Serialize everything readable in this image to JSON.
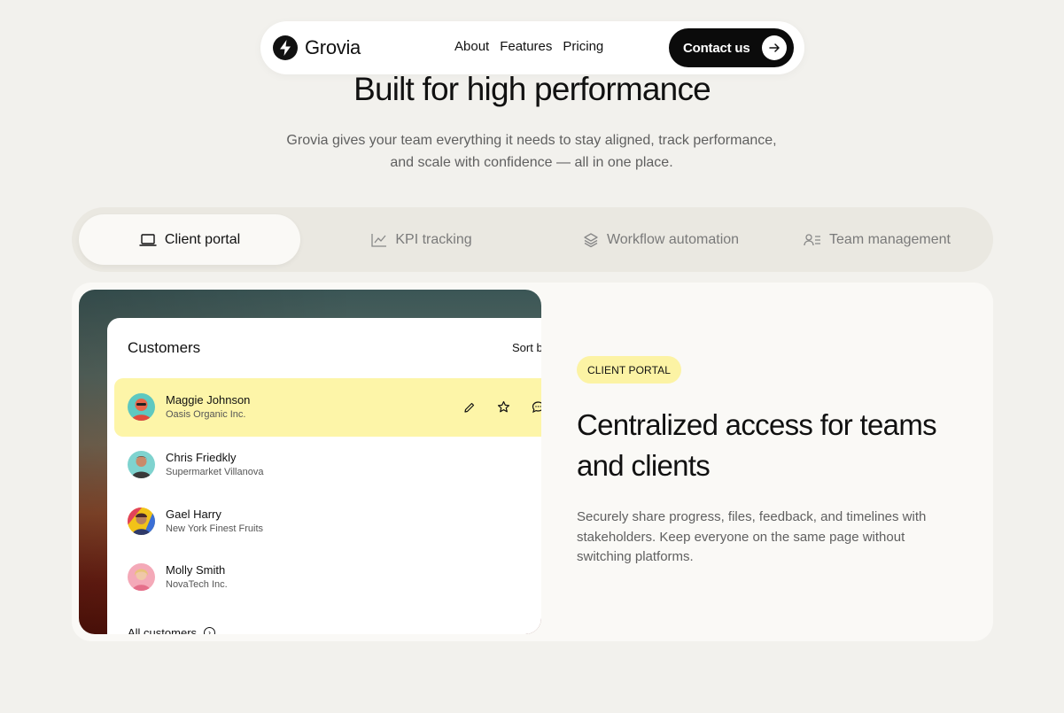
{
  "nav": {
    "brand": "Grovia",
    "links": [
      "About",
      "Features",
      "Pricing"
    ],
    "cta_label": "Contact us"
  },
  "hero": {
    "title": "Built for high performance",
    "subtitle_line1": "Grovia gives your team everything it needs to stay aligned, track performance,",
    "subtitle_line2": "and scale with confidence — all in one place."
  },
  "tabs": [
    {
      "label": "Client portal",
      "icon": "laptop-icon",
      "active": true
    },
    {
      "label": "KPI tracking",
      "icon": "chart-icon",
      "active": false
    },
    {
      "label": "Workflow automation",
      "icon": "layers-icon",
      "active": false
    },
    {
      "label": "Team management",
      "icon": "team-icon",
      "active": false
    }
  ],
  "customers_panel": {
    "title": "Customers",
    "sort_label": "Sort by",
    "rows": [
      {
        "name": "Maggie Johnson",
        "company": "Oasis Organic Inc.",
        "highlighted": true
      },
      {
        "name": "Chris Friedkly",
        "company": "Supermarket Villanova",
        "highlighted": false
      },
      {
        "name": "Gael Harry",
        "company": "New York Finest Fruits",
        "highlighted": false
      },
      {
        "name": "Molly Smith",
        "company": "NovaTech Inc.",
        "highlighted": false
      }
    ],
    "footer_label": "All customers"
  },
  "feature": {
    "badge": "CLIENT PORTAL",
    "title": "Centralized access for teams and clients",
    "description": "Securely share progress, files, feedback, and timelines with stakeholders. Keep everyone on the same page without switching platforms."
  },
  "colors": {
    "background": "#f2f1ed",
    "accent_yellow": "#fcf3a4",
    "dark": "#0b0b0b"
  }
}
